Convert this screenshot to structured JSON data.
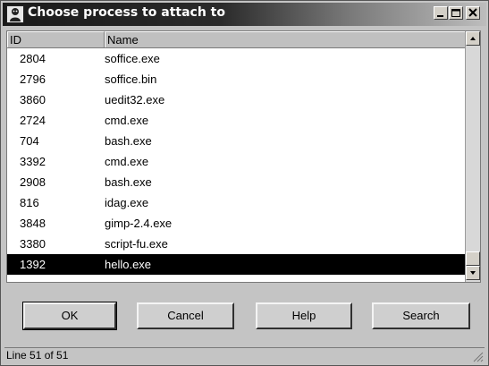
{
  "window": {
    "title": "Choose process to attach to",
    "icon": "debugger-app-icon"
  },
  "table": {
    "columns": [
      "ID",
      "Name"
    ],
    "rows": [
      {
        "id": "2804",
        "name": "soffice.exe"
      },
      {
        "id": "2796",
        "name": "soffice.bin"
      },
      {
        "id": "3860",
        "name": "uedit32.exe"
      },
      {
        "id": "2724",
        "name": "cmd.exe"
      },
      {
        "id": "704",
        "name": "bash.exe"
      },
      {
        "id": "3392",
        "name": "cmd.exe"
      },
      {
        "id": "2908",
        "name": "bash.exe"
      },
      {
        "id": "816",
        "name": "idag.exe"
      },
      {
        "id": "3848",
        "name": "gimp-2.4.exe"
      },
      {
        "id": "3380",
        "name": "script-fu.exe"
      },
      {
        "id": "1392",
        "name": "hello.exe"
      }
    ],
    "selected_id": "1392"
  },
  "buttons": {
    "ok": "OK",
    "cancel": "Cancel",
    "help": "Help",
    "search": "Search"
  },
  "status": {
    "text": "Line 51 of 51"
  },
  "colors": {
    "selection": "#000000",
    "titlebar": "#1a1a1a"
  }
}
